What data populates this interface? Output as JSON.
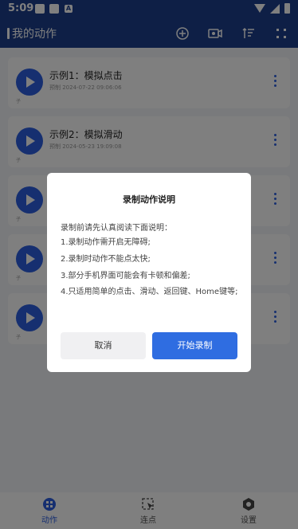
{
  "status_bar": {
    "time": "5:09",
    "notification_letter": "A"
  },
  "app_bar": {
    "title": "我的动作"
  },
  "list": {
    "items": [
      {
        "name": "示例1：模拟点击",
        "meta": "预制 2024-07-22 09:06:06",
        "tag": "子"
      },
      {
        "name": "示例2：模拟滑动",
        "meta": "预制 2024-05-23 19:09:08",
        "tag": "子"
      },
      {
        "name": "",
        "meta": "",
        "tag": "子"
      },
      {
        "name": "",
        "meta": "",
        "tag": "子"
      },
      {
        "name": "",
        "meta": "",
        "tag": "子"
      }
    ]
  },
  "dialog": {
    "title": "录制动作说明",
    "intro": "录制前请先认真阅读下面说明：",
    "items": [
      "1.录制动作需开启无障碍;",
      "2.录制时动作不能点太快;",
      "3.部分手机界面可能会有卡顿和偏差;",
      "4.只适用简单的点击、滑动、返回键、Home键等;"
    ],
    "cancel_label": "取消",
    "confirm_label": "开始录制"
  },
  "bottom_nav": {
    "items": [
      {
        "label": "动作"
      },
      {
        "label": "连点"
      },
      {
        "label": "设置"
      }
    ]
  },
  "colors": {
    "primary": "#1c3f8d",
    "accent": "#2f6de1"
  }
}
